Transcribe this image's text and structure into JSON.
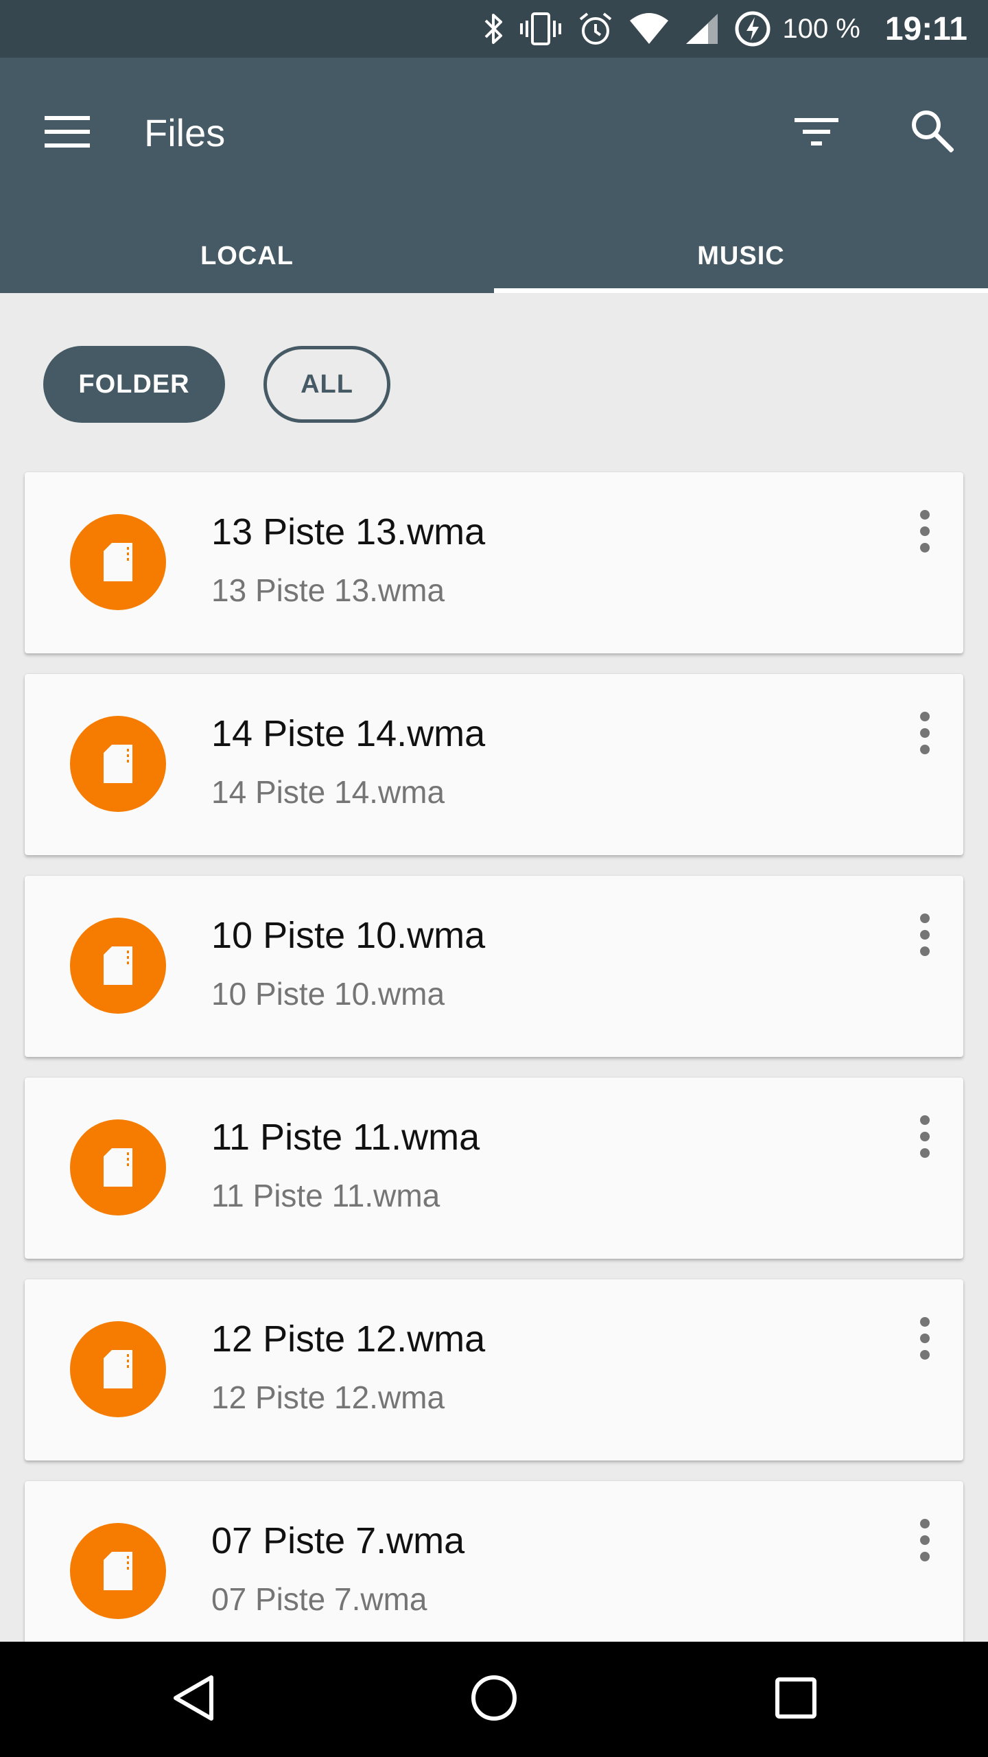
{
  "status_bar": {
    "battery_text": "100 %",
    "time": "19:11",
    "icons": [
      "bluetooth-icon",
      "vibrate-icon",
      "alarm-icon",
      "wifi-icon",
      "signal-icon",
      "battery-charging-icon"
    ]
  },
  "toolbar": {
    "title": "Files",
    "icons": [
      "menu-icon",
      "filter-icon",
      "search-icon"
    ]
  },
  "tabs": [
    {
      "label": "LOCAL",
      "selected": false
    },
    {
      "label": "MUSIC",
      "selected": true
    }
  ],
  "chips": {
    "folder_label": "FOLDER",
    "all_label": "ALL"
  },
  "files": [
    {
      "title": "13 Piste 13.wma",
      "subtitle": "13 Piste 13.wma"
    },
    {
      "title": "14 Piste 14.wma",
      "subtitle": "14 Piste 14.wma"
    },
    {
      "title": "10 Piste 10.wma",
      "subtitle": "10 Piste 10.wma"
    },
    {
      "title": "11 Piste 11.wma",
      "subtitle": "11 Piste 11.wma"
    },
    {
      "title": "12 Piste 12.wma",
      "subtitle": "12 Piste 12.wma"
    },
    {
      "title": "07 Piste 7.wma",
      "subtitle": "07 Piste 7.wma"
    }
  ],
  "colors": {
    "status_bar": "#37474f",
    "app_bar": "#455a64",
    "file_icon": "#f57c00",
    "background": "#ebebeb"
  }
}
